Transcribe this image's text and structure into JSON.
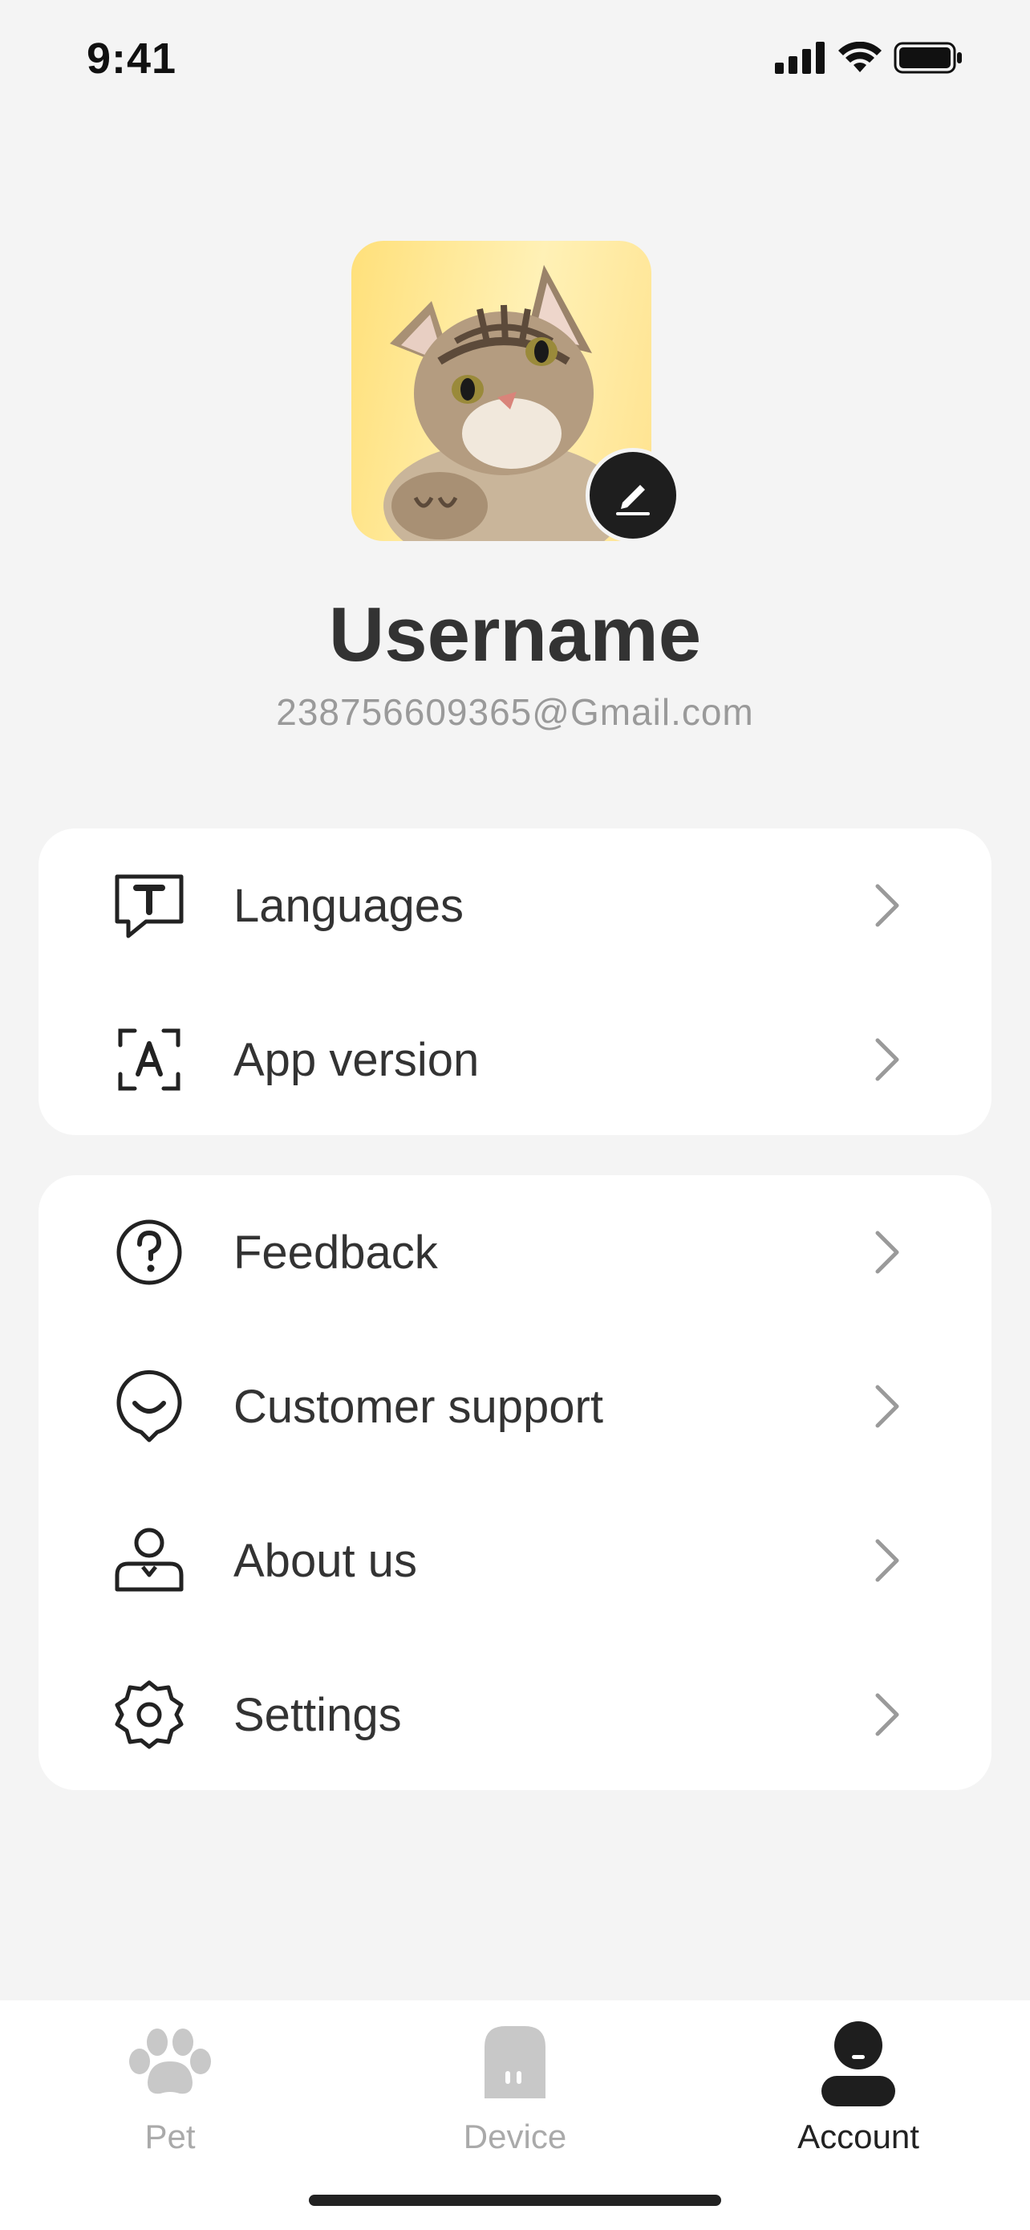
{
  "status_bar": {
    "time": "9:41",
    "icons": [
      "signal-icon",
      "wifi-icon",
      "battery-icon"
    ]
  },
  "profile": {
    "avatar": "cat-avatar-photo",
    "edit_icon": "pencil-icon",
    "username": "Username",
    "email": "238756609365@Gmail.com"
  },
  "menu_group_1": [
    {
      "label": "Languages",
      "icon": "text-bubble-icon"
    },
    {
      "label": "App version",
      "icon": "version-frame-icon"
    }
  ],
  "menu_group_2": [
    {
      "label": "Feedback",
      "icon": "question-circle-icon"
    },
    {
      "label": "Customer support",
      "icon": "support-chat-icon"
    },
    {
      "label": "About us",
      "icon": "person-icon"
    },
    {
      "label": "Settings",
      "icon": "gear-icon"
    }
  ],
  "tabbar": {
    "tabs": [
      {
        "label": "Pet",
        "icon": "paw-icon",
        "active": false
      },
      {
        "label": "Device",
        "icon": "device-icon",
        "active": false
      },
      {
        "label": "Account",
        "icon": "account-icon",
        "active": true
      }
    ]
  },
  "colors": {
    "background": "#f4f4f4",
    "card": "#ffffff",
    "text_primary": "#333333",
    "text_secondary": "#9a9a9a",
    "tab_inactive": "#aaaaaa",
    "tab_active": "#222222",
    "avatar_bg": "#ffe07a"
  }
}
